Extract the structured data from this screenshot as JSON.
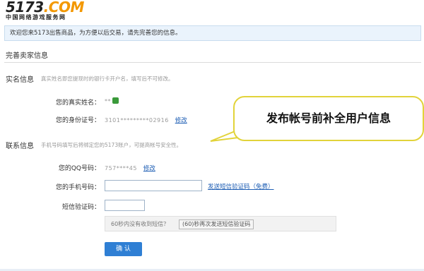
{
  "logo": {
    "main_num": "5173",
    "main_com": ".COM",
    "sub": "中国网络游戏服务网"
  },
  "notice": "欢迎您来5173出售商品，为方便以后交易，请先完善您的信息。",
  "section_title": "完善卖家信息",
  "real_name_group": {
    "title": "实名信息",
    "hint": "真实姓名即您提现时的银行卡开户名，填写后不可修改。",
    "name_label": "您的真实姓名：",
    "name_value": "**",
    "id_label": "您的身份证号：",
    "id_value": "3101*********02916",
    "id_edit": "修改"
  },
  "contact_group": {
    "title": "联系信息",
    "hint": "手机号码填写后将绑定您的5173账户，可提高帐号安全性。",
    "qq_label": "您的QQ号码：",
    "qq_value": "757****45",
    "qq_edit": "修改",
    "phone_label": "您的手机号码：",
    "phone_value": "",
    "send_code_link": "发送短信验证码（免费）",
    "sms_label": "短信验证码：",
    "sms_value": "",
    "resend_hint": "60秒内没有收到短信？",
    "resend_button": "(60)秒再次发送短信验证码"
  },
  "confirm_button": "确 认",
  "callout": "发布帐号前补全用户信息",
  "colors": {
    "accent": "#2f7fd4",
    "logo_orange": "#f39800",
    "callout_border": "#e2d33a"
  }
}
